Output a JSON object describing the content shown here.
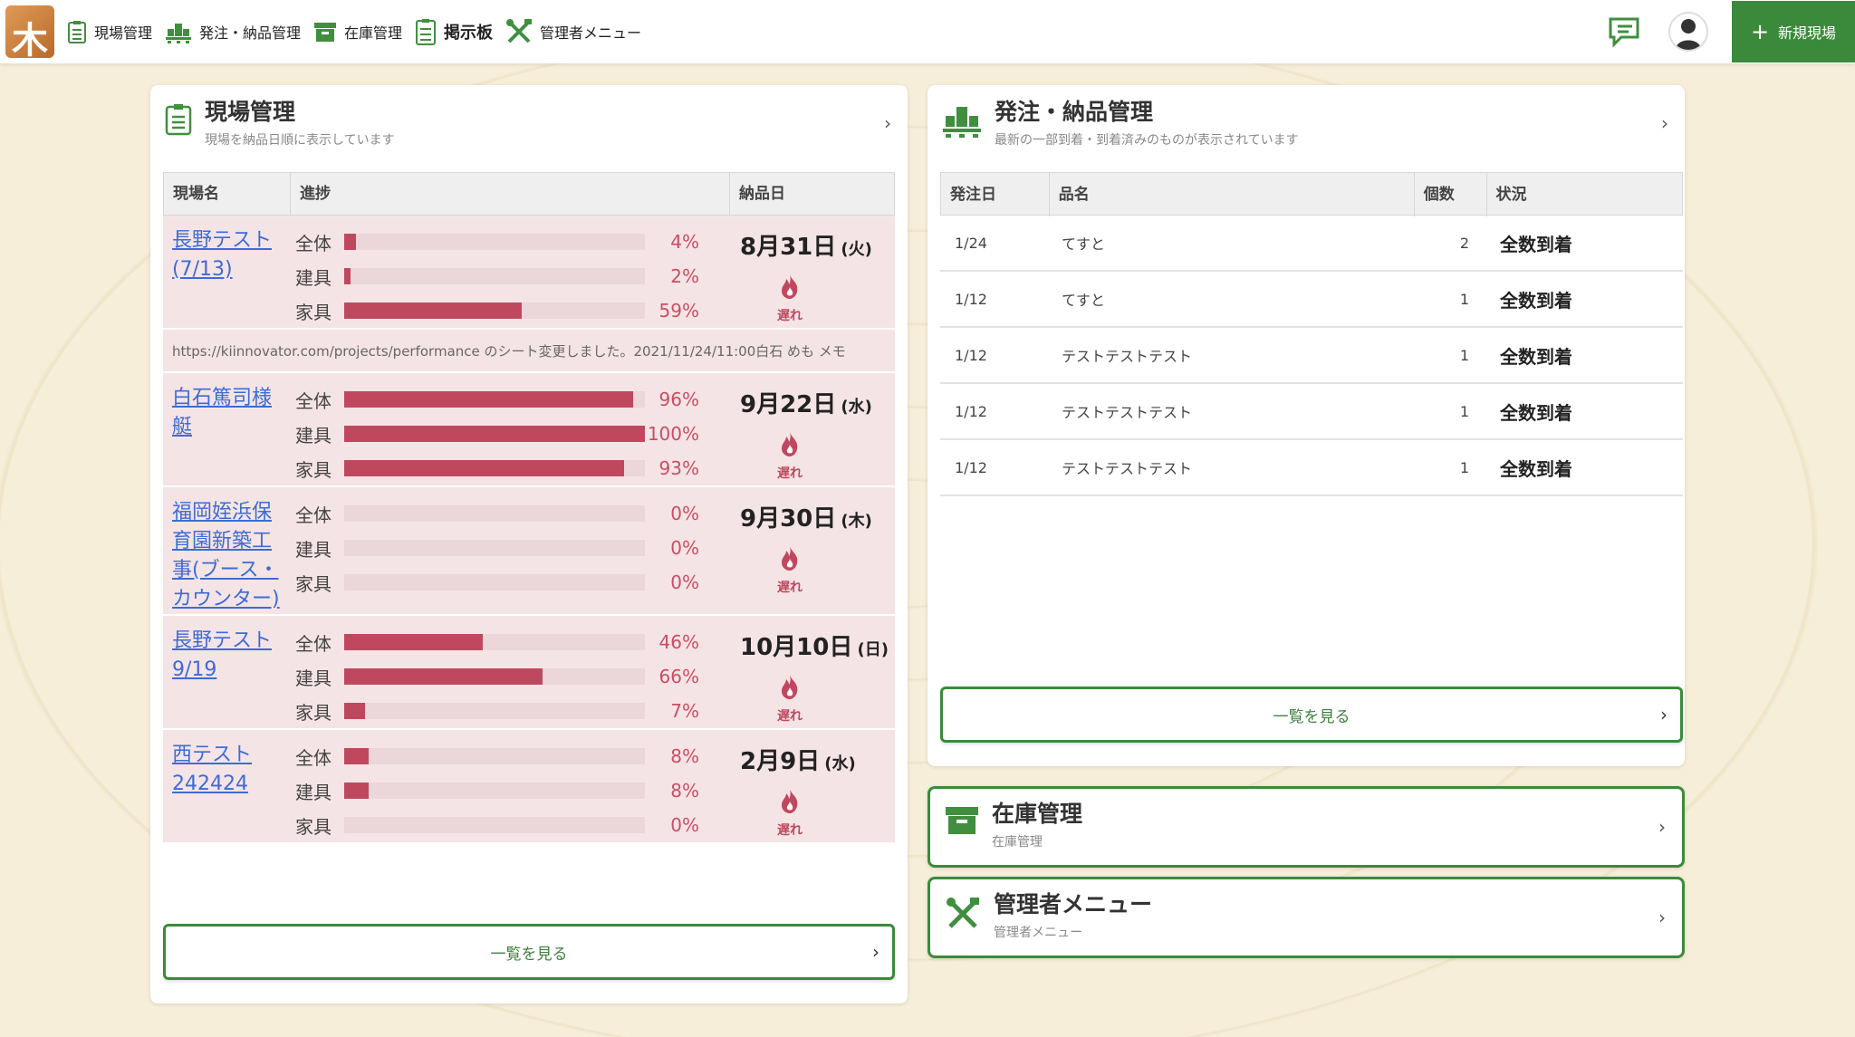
{
  "nav": {
    "items": [
      {
        "label": "現場管理"
      },
      {
        "label": "発注・納品管理"
      },
      {
        "label": "在庫管理"
      },
      {
        "label": "掲示板"
      },
      {
        "label": "管理者メニュー"
      }
    ],
    "new_site_label": "新規現場",
    "plus": "+"
  },
  "sites_card": {
    "title": "現場管理",
    "subtitle": "現場を納品日順に表示しています",
    "headers": {
      "name": "現場名",
      "progress": "進捗",
      "due": "納品日"
    },
    "categories": [
      "全体",
      "建具",
      "家具"
    ],
    "late_label": "遅れ",
    "list_button": "一覧を見る",
    "rows": [
      {
        "name": "長野テスト(7/13)",
        "progress": [
          4,
          2,
          59
        ],
        "pct": [
          "4%",
          "2%",
          "59%"
        ],
        "date": "8月31日",
        "dow": "(火)"
      },
      {
        "name": "白石篤司様艇",
        "progress": [
          96,
          100,
          93
        ],
        "pct": [
          "96%",
          "100%",
          "93%"
        ],
        "date": "9月22日",
        "dow": "(水)"
      },
      {
        "name": "福岡姪浜保育園新築工事(ブース・カウンター)",
        "progress": [
          0,
          0,
          0
        ],
        "pct": [
          "0%",
          "0%",
          "0%"
        ],
        "date": "9月30日",
        "dow": "(木)"
      },
      {
        "name": "長野テスト9/19",
        "progress": [
          46,
          66,
          7
        ],
        "pct": [
          "46%",
          "66%",
          "7%"
        ],
        "date": "10月10日",
        "dow": "(日)"
      },
      {
        "name": "西テスト242424",
        "progress": [
          8,
          8,
          0
        ],
        "pct": [
          "8%",
          "8%",
          "0%"
        ],
        "date": "2月9日",
        "dow": "(水)"
      }
    ],
    "memo": "https://kiinnovator.com/projects/performance のシート変更しました。2021/11/24/11:00白石 めも メモ"
  },
  "orders_card": {
    "title": "発注・納品管理",
    "subtitle": "最新の一部到着・到着済みのものが表示されています",
    "headers": {
      "date": "発注日",
      "item": "品名",
      "qty": "個数",
      "status": "状況"
    },
    "rows": [
      {
        "date": "1/24",
        "item": "てすと",
        "qty": "2",
        "status": "全数到着"
      },
      {
        "date": "1/12",
        "item": "てすと",
        "qty": "1",
        "status": "全数到着"
      },
      {
        "date": "1/12",
        "item": "テストテストテスト",
        "qty": "1",
        "status": "全数到着"
      },
      {
        "date": "1/12",
        "item": "テストテストテスト",
        "qty": "1",
        "status": "全数到着"
      },
      {
        "date": "1/12",
        "item": "テストテストテスト",
        "qty": "1",
        "status": "全数到着"
      }
    ],
    "list_button": "一覧を見る"
  },
  "inventory_card": {
    "title": "在庫管理",
    "subtitle": "在庫管理"
  },
  "admin_card": {
    "title": "管理者メニュー",
    "subtitle": "管理者メニュー"
  },
  "chevron": "›",
  "icons": {
    "logo": "logo-icon",
    "sites": "clipboard-icon",
    "orders": "pallet-boxes-icon",
    "inventory": "box-icon",
    "board": "clipboard-list-icon",
    "admin": "tools-icon",
    "chat": "chat-icon",
    "user": "user-avatar-icon",
    "late": "fire-icon"
  },
  "colors": {
    "brand_green": "#3b8a3b",
    "progress_fill": "#c0485e",
    "row_bg": "#f5e4e6",
    "link": "#3d6bd6"
  }
}
